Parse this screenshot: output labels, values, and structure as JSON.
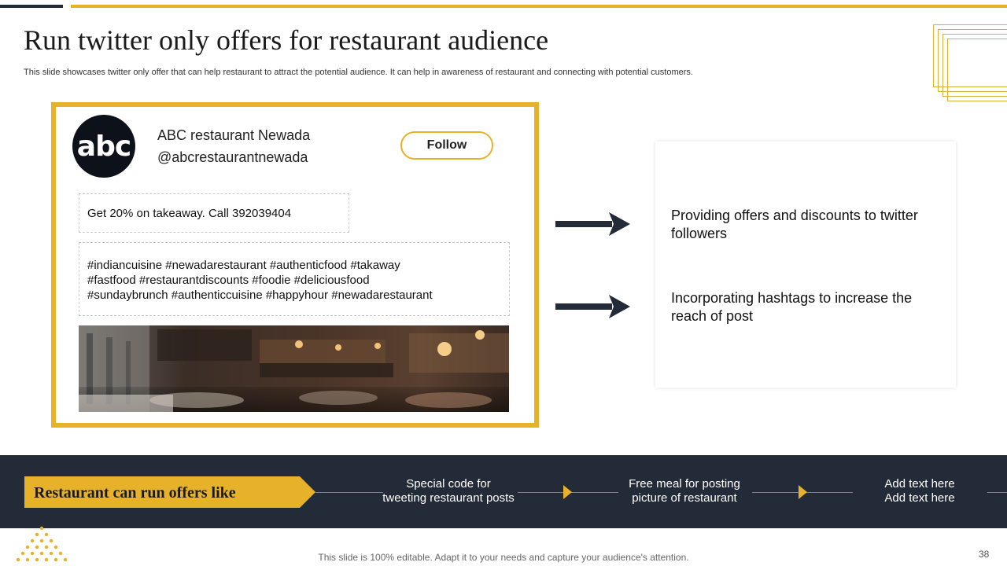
{
  "slide": {
    "title": "Run twitter only offers for restaurant audience",
    "subtitle": "This slide showcases twitter only offer that can help restaurant to attract the potential audience. It can help in awareness of restaurant and connecting with potential customers."
  },
  "tweet": {
    "logo_text": "abc",
    "account_name": "ABC restaurant Newada",
    "handle": "@abcrestaurantnewada",
    "follow_label": "Follow",
    "offer_text": "Get 20% on takeaway. Call 392039404",
    "hashtag_lines": [
      "#indiancuisine #newadarestaurant  #authenticfood  #takaway",
      "#fastfood #restaurantdiscounts  #foodie #deliciousfood",
      "#sundaybrunch  #authenticcuisine  #happyhour  #newadarestaurant"
    ]
  },
  "points": [
    {
      "text": "Providing offers and discounts to twitter followers"
    },
    {
      "text": "Incorporating hashtags to increase the reach of post"
    }
  ],
  "offers_band": {
    "banner_label": "Restaurant  can run  offers like",
    "steps": [
      {
        "line1": "Special code for",
        "line2": "tweeting restaurant posts"
      },
      {
        "line1": "Free meal for posting",
        "line2": "picture of restaurant"
      },
      {
        "line1": "Add text here",
        "line2": "Add text here"
      }
    ]
  },
  "footer": {
    "note": "This slide is 100% editable. Adapt it to your needs and capture your audience's attention.",
    "page_number": "38"
  },
  "colors": {
    "gold": "#e8b12a",
    "navy": "#232a38"
  },
  "icons": [
    "abc-logo-icon",
    "right-arrow-icon",
    "chevron-triangle-icon",
    "dot-triangle-logo-icon"
  ]
}
